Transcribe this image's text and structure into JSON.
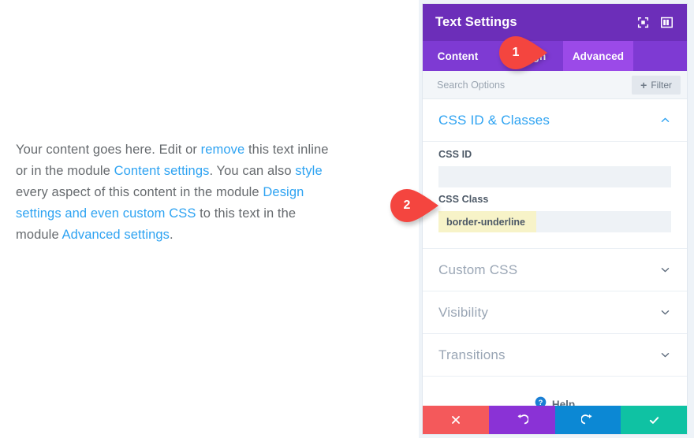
{
  "content": {
    "paragraph_parts": [
      {
        "text": "Your content goes here. Edit or ",
        "link": false
      },
      {
        "text": "remove",
        "link": true
      },
      {
        "text": " this text inline or in the module ",
        "link": false
      },
      {
        "text": "Content settings",
        "link": true
      },
      {
        "text": ". You can also ",
        "link": false
      },
      {
        "text": "style",
        "link": true
      },
      {
        "text": " every aspect of this content in the module ",
        "link": false
      },
      {
        "text": "Design settings and even custom CSS",
        "link": true
      },
      {
        "text": " to this text in the module ",
        "link": false
      },
      {
        "text": "Advanced settings",
        "link": true
      },
      {
        "text": ".",
        "link": false
      }
    ],
    "link_color": "#2ea3f2",
    "text_color": "#666a6e"
  },
  "panel": {
    "title": "Text Settings",
    "title_icons": [
      {
        "name": "focus-target-icon",
        "label": "Focus"
      },
      {
        "name": "panel-layout-icon",
        "label": "Layout"
      }
    ],
    "header_color": "#6c2eb9",
    "tabbar_color": "#7e3ad3",
    "active_tab_color": "#9b4ae8",
    "tabs": [
      {
        "label": "Content",
        "active": false
      },
      {
        "label": "Design",
        "active": false
      },
      {
        "label": "Advanced",
        "active": true
      }
    ],
    "search": {
      "placeholder": "Search Options",
      "value": ""
    },
    "filter_button": {
      "label": "Filter",
      "plus": "+"
    },
    "sections": [
      {
        "title": "CSS ID & Classes",
        "state": "open",
        "chevron": "up",
        "fields": [
          {
            "label": "CSS ID",
            "value": "",
            "highlighted": false
          },
          {
            "label": "CSS Class",
            "value": "border-underline",
            "highlighted": true
          }
        ]
      },
      {
        "title": "Custom CSS",
        "state": "closed",
        "chevron": "down"
      },
      {
        "title": "Visibility",
        "state": "closed",
        "chevron": "down"
      },
      {
        "title": "Transitions",
        "state": "closed",
        "chevron": "down"
      }
    ],
    "help": {
      "label": "Help",
      "icon": "question-mark-circle-icon"
    },
    "actions": [
      {
        "name": "cancel",
        "icon": "close-x-icon",
        "color": "#f4595b",
        "glyph": "✕"
      },
      {
        "name": "undo",
        "icon": "undo-arrow-icon",
        "color": "#8a32d6",
        "glyph": "↺"
      },
      {
        "name": "redo",
        "icon": "redo-arrow-icon",
        "color": "#0c88d4",
        "glyph": "↻"
      },
      {
        "name": "save",
        "icon": "checkmark-icon",
        "color": "#0fc2a3",
        "glyph": "✓"
      }
    ]
  },
  "annotations": {
    "marker_color": "#f4453f",
    "steps": [
      {
        "number": "1",
        "points_to": "advanced-tab"
      },
      {
        "number": "2",
        "points_to": "css-class-field"
      }
    ]
  }
}
